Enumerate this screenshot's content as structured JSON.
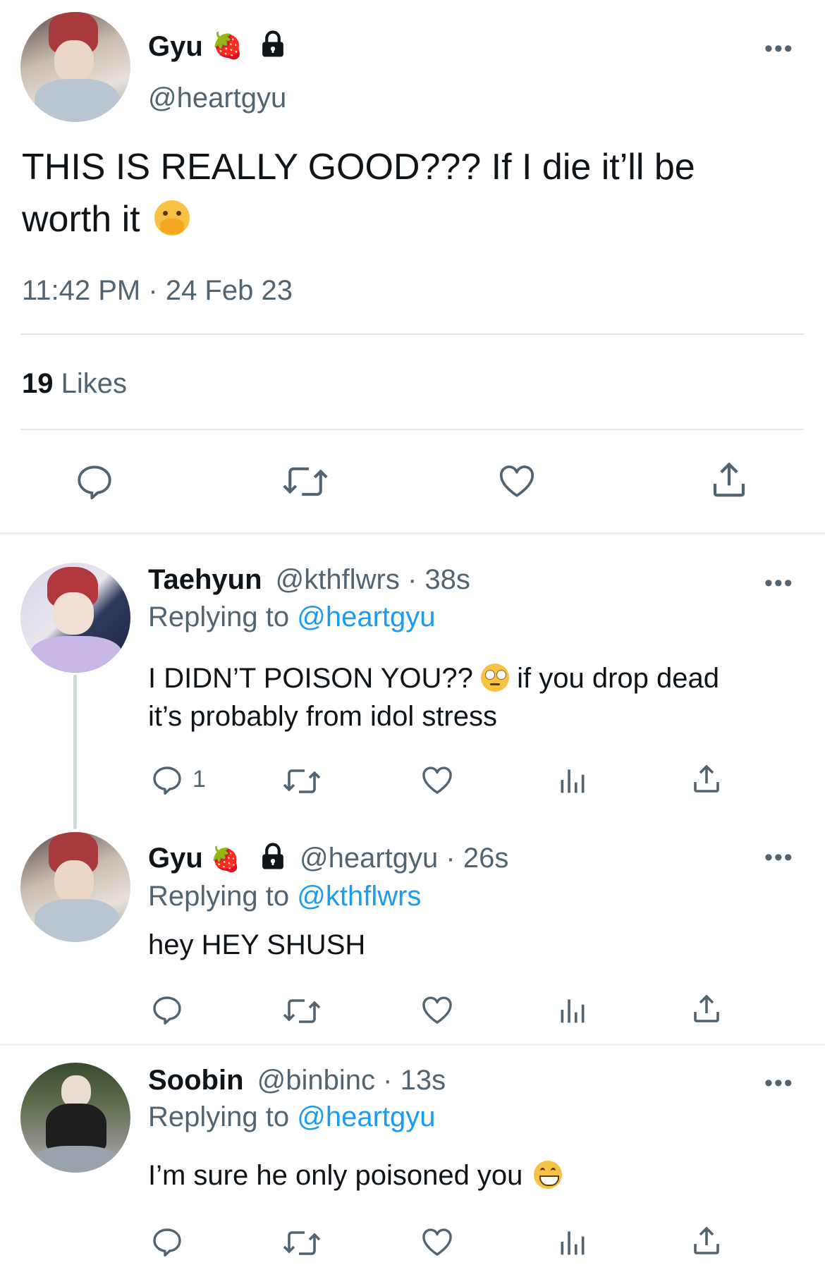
{
  "main_tweet": {
    "display_name": "Gyu",
    "handle": "@heartgyu",
    "strawberry_emoji": "🍓",
    "lock_icon": "lock-icon",
    "text": "THIS IS REALLY GOOD??? If I die it’ll be",
    "text_line2": "worth it",
    "emoji_name": "face-with-hand-over-mouth",
    "time": "11:42 PM",
    "sep": "·",
    "date": "24 Feb 23",
    "likes_count": "19",
    "likes_label": "Likes"
  },
  "replies": [
    {
      "display_name": "Taehyun",
      "handle": "@kthflwrs",
      "sep": "·",
      "time": "38s",
      "replying_label": "Replying to",
      "replying_to": "@heartgyu",
      "text_a": "I DIDN’T POISON YOU??",
      "text_b": "if you drop dead",
      "text_line2": "it’s probably from idol stress",
      "emoji_name": "face-with-rolling-eyes",
      "reply_count": "1"
    },
    {
      "display_name": "Gyu",
      "strawberry_emoji": "🍓",
      "handle": "@heartgyu",
      "sep": "·",
      "time": "26s",
      "replying_label": "Replying to",
      "replying_to": "@kthflwrs",
      "text": "hey HEY SHUSH"
    },
    {
      "display_name": "Soobin",
      "handle": "@binbinc",
      "sep": "·",
      "time": "13s",
      "replying_label": "Replying to",
      "replying_to": "@heartgyu",
      "text": "I’m sure he only poisoned you",
      "emoji_name": "grinning-face-with-smiling-eyes"
    }
  ],
  "more_label": "•••",
  "colors": {
    "text": "#0f1419",
    "secondary": "#536471",
    "link": "#1d9bf0",
    "divider": "#e7e7e7"
  }
}
